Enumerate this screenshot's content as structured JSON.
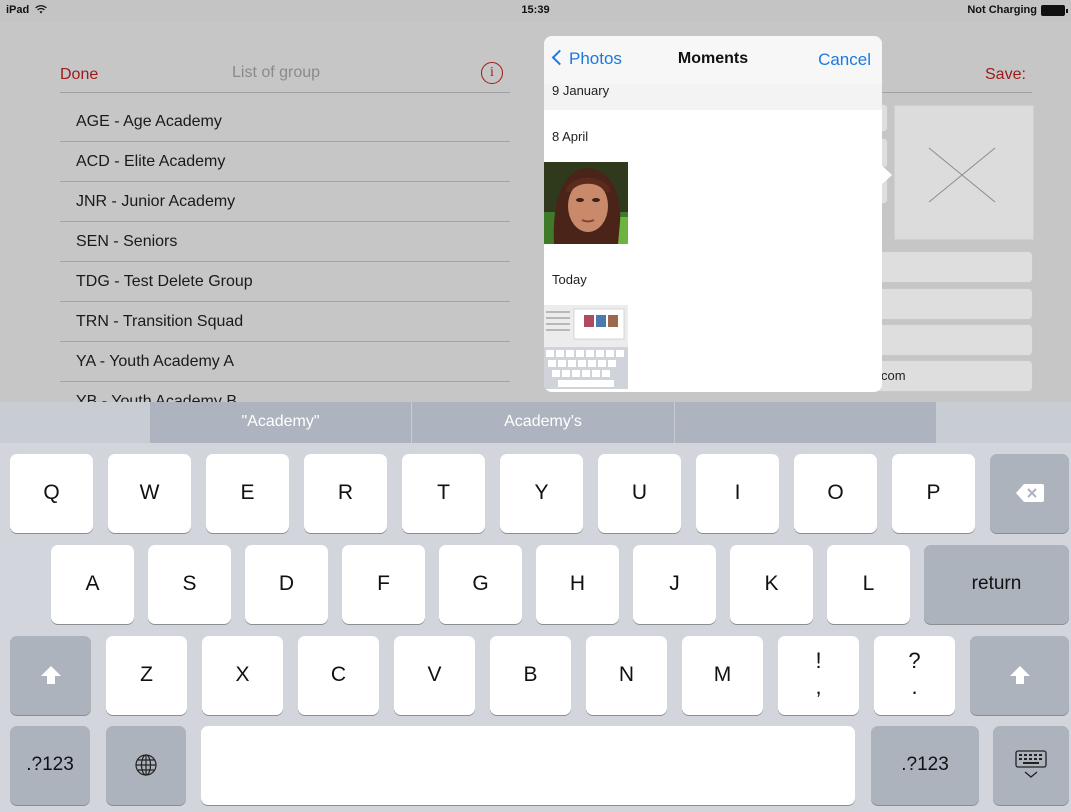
{
  "status_bar": {
    "device": "iPad",
    "time": "15:39",
    "battery_status": "Not Charging"
  },
  "groups_panel": {
    "done_label": "Done",
    "title": "List of group",
    "info_glyph": "i",
    "items": [
      "AGE - Age Academy",
      "ACD - Elite Academy",
      "JNR - Junior Academy",
      "SEN - Seniors",
      "TDG - Test Delete Group",
      "TRN - Transition Squad",
      "YA - Youth Academy A",
      "YB - Youth Academy B"
    ]
  },
  "form": {
    "save_label": "Save:",
    "email_visible_fragment": "com"
  },
  "photos_popover": {
    "back_label": "Photos",
    "title": "Moments",
    "cancel_label": "Cancel",
    "sections": [
      "9 January",
      "8 April",
      "Today"
    ]
  },
  "keyboard": {
    "suggestions": [
      "\"Academy\"",
      "Academy's",
      ""
    ],
    "row1": [
      "Q",
      "W",
      "E",
      "R",
      "T",
      "Y",
      "U",
      "I",
      "O",
      "P"
    ],
    "row2": [
      "A",
      "S",
      "D",
      "F",
      "G",
      "H",
      "J",
      "K",
      "L"
    ],
    "row3": [
      "Z",
      "X",
      "C",
      "V",
      "B",
      "N",
      "M"
    ],
    "punct_exclaim": [
      "!",
      ","
    ],
    "punct_question": [
      "?",
      "."
    ],
    "return_label": "return",
    "numbers_label": ".?123",
    "icons": {
      "delete": "backspace-icon",
      "shift": "shift-icon",
      "globe": "globe-icon",
      "hide": "keyboard-hide-icon",
      "back": "chevron-left-icon",
      "info": "info-icon"
    }
  },
  "colors": {
    "accent_red": "#9b1b1b",
    "ios_blue": "#1a7ae0"
  }
}
